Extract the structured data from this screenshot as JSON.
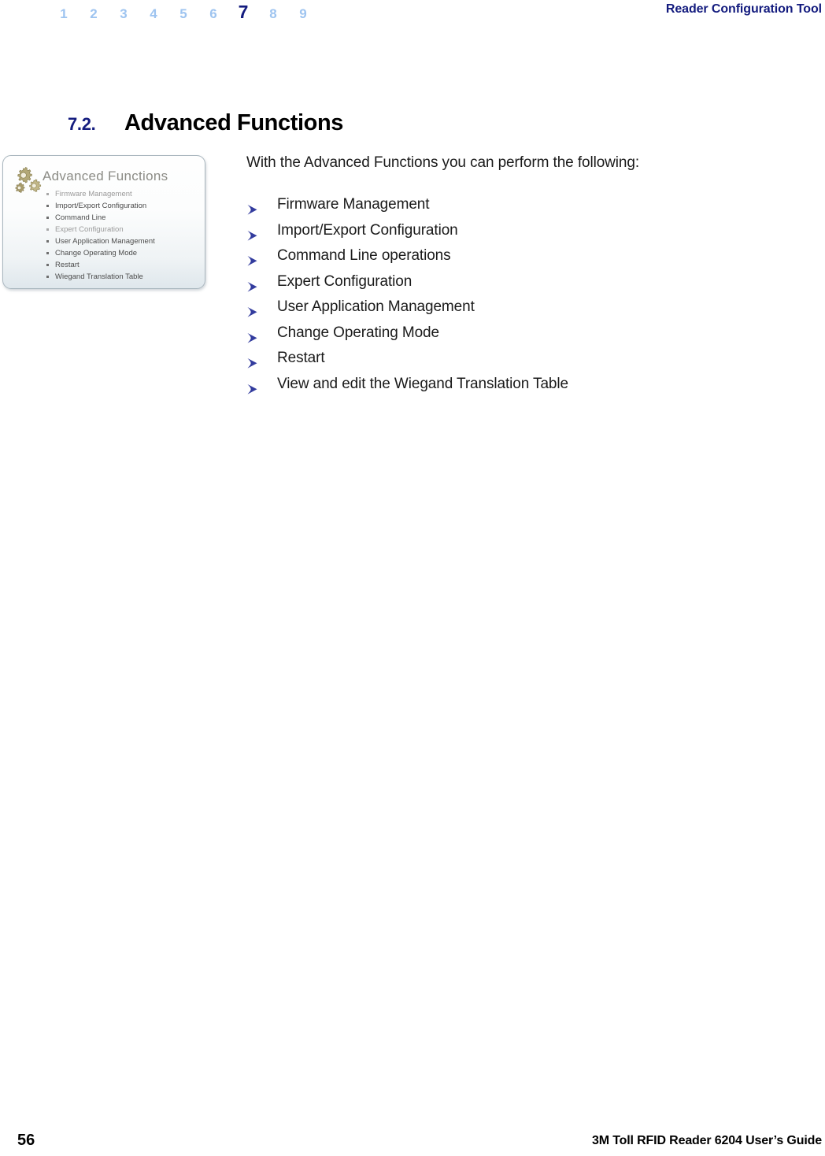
{
  "header": {
    "chapter_numbers": [
      "1",
      "2",
      "3",
      "4",
      "5",
      "6",
      "7",
      "8",
      "9"
    ],
    "active_chapter": "7",
    "title": "Reader Configuration Tool",
    "active_color": "#131B7E",
    "inactive_color": "#9EC4F0"
  },
  "section": {
    "number": "7.2.",
    "title": "Advanced Functions",
    "number_color": "#131B7E"
  },
  "figure": {
    "icon": "gears-icon",
    "title": "Advanced Functions",
    "items": [
      {
        "label": "Firmware Management",
        "dim": true
      },
      {
        "label": "Import/Export Configuration",
        "dim": false
      },
      {
        "label": "Command Line",
        "dim": false
      },
      {
        "label": "Expert Configuration",
        "dim": true
      },
      {
        "label": "User Application Management",
        "dim": false
      },
      {
        "label": "Change Operating Mode",
        "dim": false
      },
      {
        "label": "Restart",
        "dim": false
      },
      {
        "label": "Wiegand Translation Table",
        "dim": false
      }
    ]
  },
  "body": {
    "intro": "With the Advanced Functions you can perform the following:",
    "bullet_color": "#333C9E",
    "bullets": [
      "Firmware Management",
      "Import/Export Configuration",
      "Command Line operations",
      "Expert Configuration",
      "User Application Management",
      "Change Operating Mode",
      "Restart",
      "View and edit the Wiegand Translation Table"
    ]
  },
  "footer": {
    "page_number": "56",
    "guide_title": "3M Toll RFID Reader 6204 User’s Guide"
  }
}
